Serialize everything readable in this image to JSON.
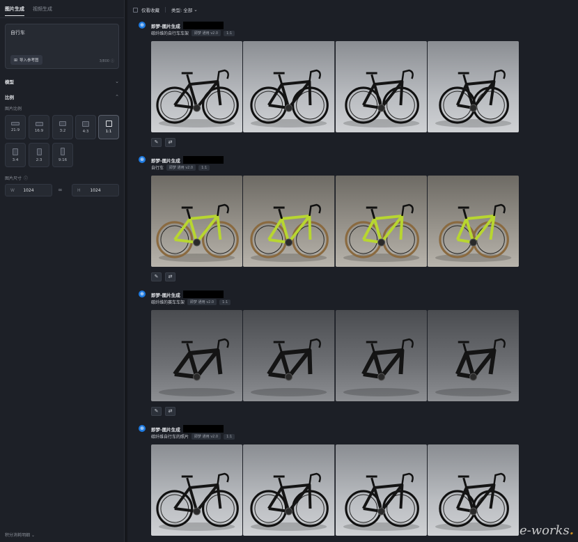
{
  "sidebar": {
    "tabs": [
      {
        "label": "图片生成",
        "active": true
      },
      {
        "label": "视频生成",
        "active": false
      }
    ],
    "prompt": {
      "value": "自行车",
      "ref_button": "导入参考图",
      "counter": "3/800"
    },
    "model_label": "模型",
    "ratio_label": "比例",
    "ratio_sub": "图片比例",
    "ratios": [
      {
        "label": "21:9",
        "active": false
      },
      {
        "label": "16:9",
        "active": false
      },
      {
        "label": "3:2",
        "active": false
      },
      {
        "label": "4:3",
        "active": false
      },
      {
        "label": "1:1",
        "active": true
      },
      {
        "label": "3:4",
        "active": false
      },
      {
        "label": "2:3",
        "active": false
      },
      {
        "label": "9:16",
        "active": false
      }
    ],
    "size_label": "图片尺寸",
    "width": {
      "key": "W",
      "value": "1024"
    },
    "height": {
      "key": "H",
      "value": "1024"
    },
    "footer": "积分消耗明细"
  },
  "topbar": {
    "favorites_label": "仅看收藏",
    "type_label": "类型: 全部"
  },
  "records": [
    {
      "title": "即梦-图片生成",
      "prompt": "碳纤维的自行车车架",
      "model": "即梦 通用 v2.0",
      "ratio": "1:1",
      "theme": "black"
    },
    {
      "title": "即梦-图片生成",
      "prompt": "自行车",
      "model": "即梦 通用 v2.0",
      "ratio": "1:1",
      "theme": "lime"
    },
    {
      "title": "即梦-图片生成",
      "prompt": "碳纤维的赛车车架",
      "model": "即梦 通用 v2.0",
      "ratio": "1:1",
      "theme": "frame"
    },
    {
      "title": "即梦-图片生成",
      "prompt": "碳纤维自行车的照片",
      "model": "即梦 通用 v2.0",
      "ratio": "1:1",
      "theme": "black"
    }
  ],
  "colors": {
    "accent": "#1e7ae0",
    "lime": "#b8d630",
    "carbon": "#141414"
  },
  "watermark": {
    "main": "e-works",
    "dot": "."
  }
}
